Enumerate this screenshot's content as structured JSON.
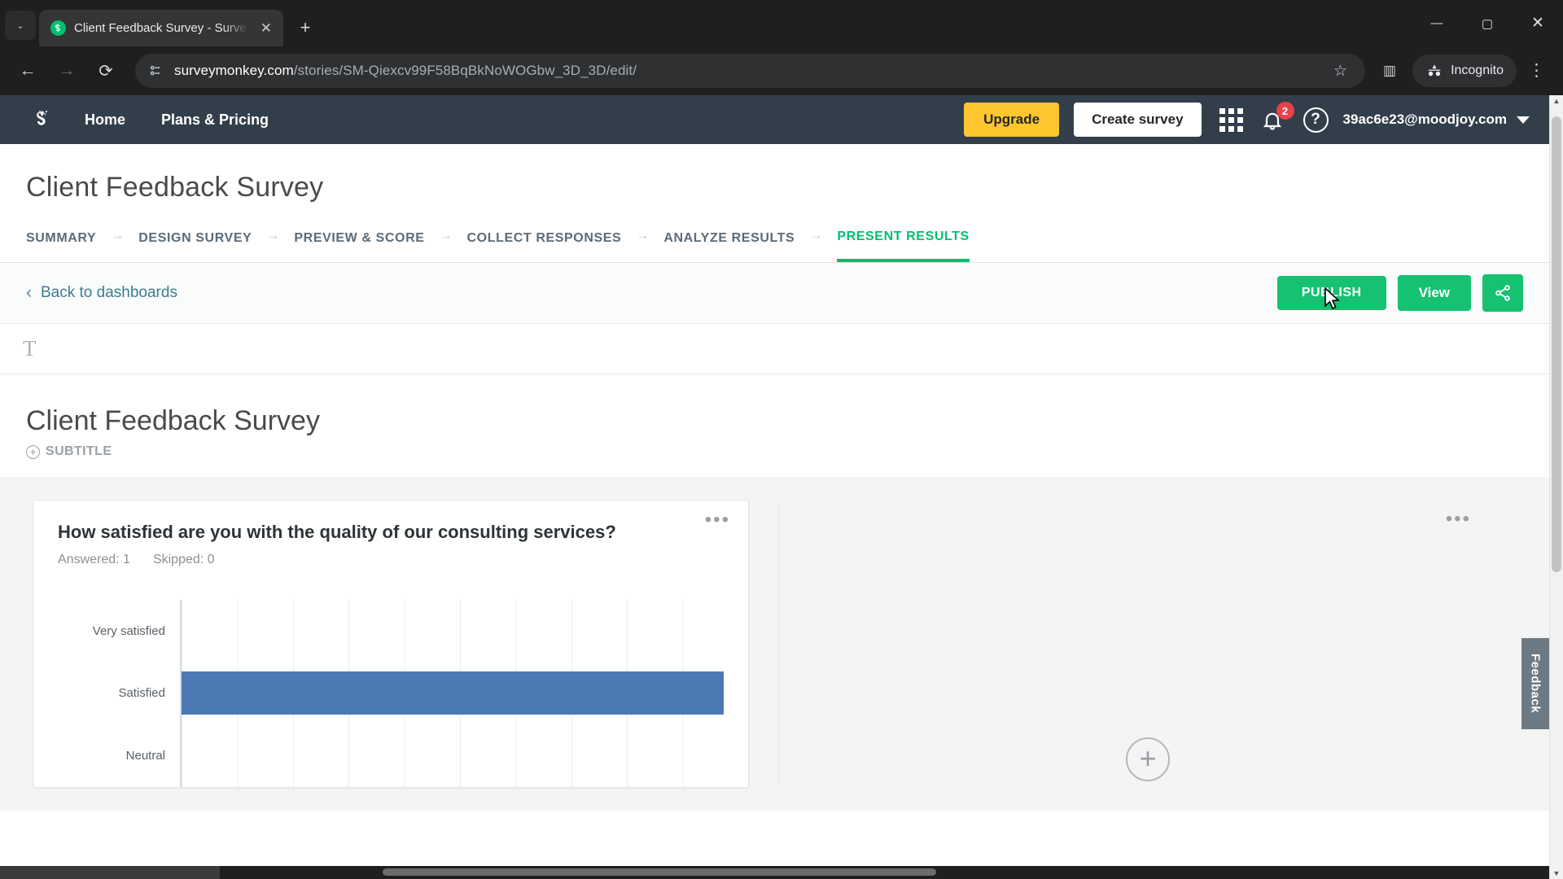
{
  "browser": {
    "tab": {
      "title": "Client Feedback Survey - Surve",
      "close_label": "✕",
      "favicon": "surveymonkey-favicon"
    },
    "newtab_label": "+",
    "tablist_label": "⌄",
    "window": {
      "minimize": "—",
      "maximize": "▢",
      "close": "✕"
    },
    "nav": {
      "back": "←",
      "forward": "→",
      "reload": "⟳"
    },
    "url": {
      "host": "surveymonkey.com",
      "path": "/stories/SM-Qiexcv99F58BqBkNoWOGbw_3D_3D/edit/",
      "full": "surveymonkey.com/stories/SM-Qiexcv99F58BqBkNoWOGbw_3D_3D/edit/"
    },
    "star_label": "☆",
    "panel_label": "▥",
    "incognito_label": "Incognito",
    "menu_label": "⋮"
  },
  "app_nav": {
    "links": [
      {
        "label": "Home"
      },
      {
        "label": "Plans & Pricing"
      }
    ],
    "upgrade_label": "Upgrade",
    "create_survey_label": "Create survey",
    "apps_icon": "grid-apps-icon",
    "notifications": {
      "count": "2",
      "icon": "bell-icon"
    },
    "help_label": "?",
    "account_email": "39ac6e23@moodjoy.com"
  },
  "survey": {
    "title": "Client Feedback Survey",
    "tabs": [
      {
        "label": "SUMMARY",
        "active": false
      },
      {
        "label": "DESIGN SURVEY",
        "active": false
      },
      {
        "label": "PREVIEW & SCORE",
        "active": false
      },
      {
        "label": "COLLECT RESPONSES",
        "active": false
      },
      {
        "label": "ANALYZE RESULTS",
        "active": false
      },
      {
        "label": "PRESENT RESULTS",
        "active": true
      }
    ],
    "tab_separator": "→"
  },
  "actions": {
    "back_label": "Back to dashboards",
    "back_chevron": "‹",
    "publish_label": "PUBLISH",
    "view_label": "View",
    "share_icon": "share-icon"
  },
  "editor_toolbar": {
    "text_tool_label": "T"
  },
  "dashboard": {
    "title": "Client Feedback Survey",
    "subtitle_label": "SUBTITLE",
    "subtitle_add": "+",
    "card": {
      "question": "How satisfied are you with the quality of our consulting services?",
      "answered_label": "Answered: 1",
      "skipped_label": "Skipped: 0",
      "kebab_label": "•••"
    },
    "right_panel": {
      "kebab_label": "•••",
      "add_widget_label": "+"
    },
    "feedback_tab_label": "Feedback"
  },
  "chart_data": {
    "type": "bar",
    "orientation": "horizontal",
    "title": "How satisfied are you with the quality of our consulting services?",
    "categories": [
      "Very satisfied",
      "Satisfied",
      "Neutral"
    ],
    "values": [
      0,
      1,
      0
    ],
    "bar_color": "#4c79b4",
    "xlabel": "",
    "ylabel": "",
    "xlim": [
      0,
      1
    ],
    "grid": true,
    "legend": "none",
    "answered": 1,
    "skipped": 0
  },
  "colors": {
    "brand_green": "#00bf6f",
    "publish_green": "#16c172",
    "upgrade_yellow": "#ffc62e",
    "nav_dark": "#323f4b",
    "bar_blue": "#4c79b4",
    "badge_red": "#e8414a"
  }
}
